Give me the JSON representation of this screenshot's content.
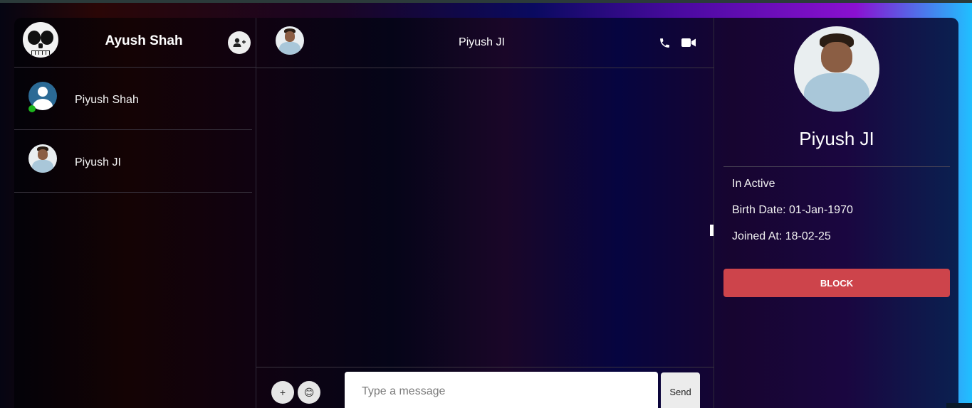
{
  "sidebar": {
    "current_user": "Ayush Shah",
    "contacts": [
      {
        "name": "Piyush Shah",
        "online": true,
        "avatar": "default-user-avatar"
      },
      {
        "name": "Piyush JI",
        "online": false,
        "avatar": "photo-avatar"
      }
    ]
  },
  "chat": {
    "title": "Piyush JI",
    "input_placeholder": "Type a message",
    "input_value": "",
    "send_label": "Send",
    "attach_glyph": "+",
    "emoji_glyph": "😊"
  },
  "profile": {
    "name": "Piyush JI",
    "status": "In Active",
    "birth_date": "Birth Date: 01-Jan-1970",
    "joined_at": "Joined At: 18-02-25",
    "block_label": "BLOCK"
  },
  "colors": {
    "block_red": "#cd444b",
    "online_green": "#1db31d"
  }
}
